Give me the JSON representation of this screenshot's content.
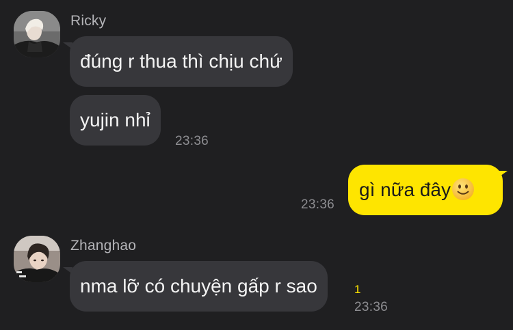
{
  "messages": [
    {
      "sender": "Ricky",
      "bubbles": [
        "đúng r thua thì chịu chứ",
        "yujin nhỉ"
      ],
      "time": "23:36",
      "avatar_icon": "profile-photo-icon"
    },
    {
      "sender": "me",
      "text": "gì nữa đây",
      "emoji": "slightly-smiling-face-icon",
      "time": "23:36"
    },
    {
      "sender": "Zhanghao",
      "bubbles": [
        "nma lỡ có chuyện gấp r sao"
      ],
      "time": "23:36",
      "unread_count": "1",
      "avatar_icon": "profile-photo-icon"
    }
  ],
  "colors": {
    "background": "#1f1f21",
    "incoming_bubble": "#37373b",
    "outgoing_bubble": "#fee500",
    "unread_count": "#fee500"
  }
}
